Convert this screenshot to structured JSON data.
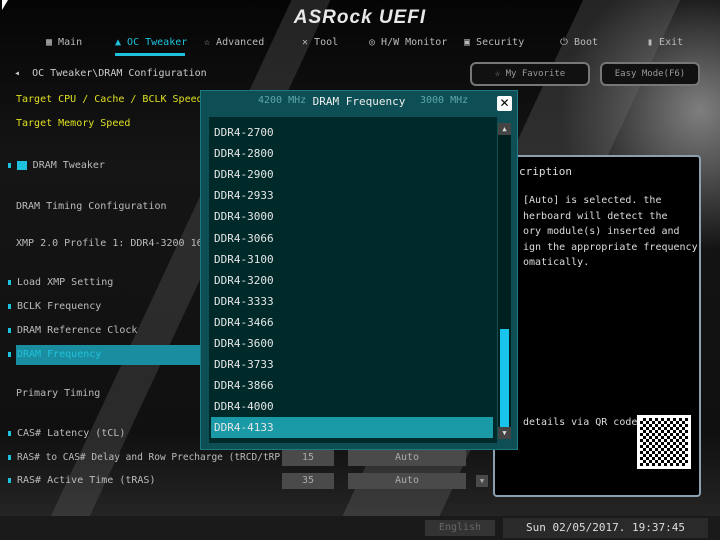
{
  "header": {
    "logo": "ASRock UEFI"
  },
  "nav": [
    {
      "label": "Main",
      "icon": "grid-icon"
    },
    {
      "label": "OC Tweaker",
      "icon": "flame-icon",
      "active": true
    },
    {
      "label": "Advanced",
      "icon": "star-icon"
    },
    {
      "label": "Tool",
      "icon": "tools-icon"
    },
    {
      "label": "H/W Monitor",
      "icon": "monitor-icon"
    },
    {
      "label": "Security",
      "icon": "shield-icon"
    },
    {
      "label": "Boot",
      "icon": "power-icon"
    },
    {
      "label": "Exit",
      "icon": "exit-icon"
    }
  ],
  "breadcrumb": "OC Tweaker\\DRAM Configuration",
  "buttons": {
    "favorite": "My Favorite",
    "easy_mode": "Easy Mode(F6)"
  },
  "settings": {
    "target_cpu": "Target CPU / Cache / BCLK Speed",
    "target_cpu_value": "4200 MHz",
    "target_cpu_value2": "3000 MHz",
    "target_mem": "Target Memory Speed",
    "dram_tweaker": "DRAM Tweaker",
    "timing_config": "DRAM Timing Configuration",
    "xmp": "XMP 2.0 Profile 1: DDR4-3200 16-",
    "load_xmp": "Load XMP Setting",
    "bclk": "BCLK Frequency",
    "ref_clock": "DRAM Reference Clock",
    "dram_freq": "DRAM Frequency",
    "primary": "Primary Timing",
    "cas": "CAS# Latency (tCL)",
    "rcd": "RAS# to CAS# Delay and Row Precharge (tRCD/tRP)",
    "rcd_value": "15",
    "rcd_auto": "Auto",
    "ras": "RAS# Active Time (tRAS)",
    "ras_value": "35",
    "ras_auto": "Auto"
  },
  "description": {
    "title": "cription",
    "body": "[Auto] is selected. the\nherboard will detect the\nory module(s) inserted and\nign the appropriate frequency\nomatically.",
    "qr_label": "details via QR code"
  },
  "footer": {
    "language": "English",
    "datetime": "Sun 02/05/2017. 19:37:45"
  },
  "modal": {
    "title": "DRAM Frequency",
    "close": "✕",
    "selected": "DDR4-4133",
    "scroll_position_percent": 100,
    "options": [
      "DDR4-2700",
      "DDR4-2800",
      "DDR4-2900",
      "DDR4-2933",
      "DDR4-3000",
      "DDR4-3066",
      "DDR4-3100",
      "DDR4-3200",
      "DDR4-3333",
      "DDR4-3466",
      "DDR4-3600",
      "DDR4-3733",
      "DDR4-3866",
      "DDR4-4000",
      "DDR4-4133"
    ]
  },
  "colors": {
    "accent": "#1fc2dc",
    "highlight": "#1a9aa6",
    "modal_bg": "#002a2a",
    "label_yellow": "#e0e020"
  }
}
